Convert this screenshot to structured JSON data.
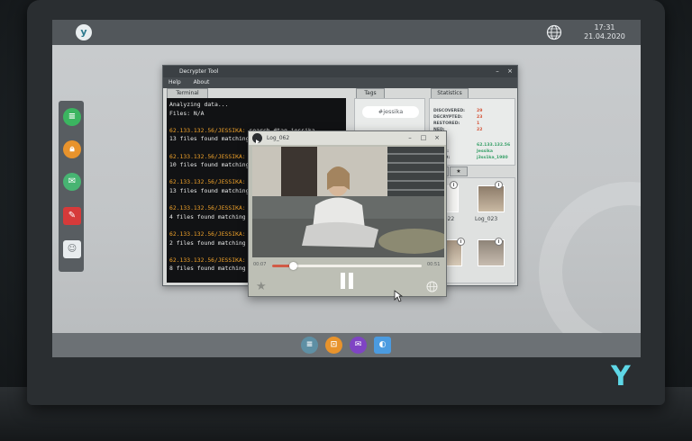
{
  "desktop": {
    "clock_time": "17:31",
    "clock_date": "21.04.2020"
  },
  "icons": {
    "brand": "y-logo-icon",
    "network": "globe-icon",
    "side_dock": [
      "chat-icon",
      "lock-icon",
      "mail-icon",
      "note-icon",
      "contact-icon"
    ],
    "taskbar": [
      "chat-icon",
      "lock-icon",
      "mail-icon",
      "browser-icon"
    ]
  },
  "decrypter": {
    "title": "Decrypter Tool",
    "menu": [
      "Help",
      "About"
    ],
    "tabs": {
      "terminal": "Terminal",
      "tags": "Tags",
      "statistics": "Statistics"
    },
    "terminal_lines": [
      {
        "prompt": "",
        "text": "Analyzing data..."
      },
      {
        "prompt": "",
        "text": "Files: N/A"
      },
      {
        "prompt": "",
        "text": ""
      },
      {
        "prompt": "62.133.132.56/JESSIKA:",
        "text": " search #tag jessika"
      },
      {
        "prompt": "",
        "text": "13 files found matching"
      },
      {
        "prompt": "",
        "text": ""
      },
      {
        "prompt": "62.133.132.56/JESSIKA:",
        "text": ""
      },
      {
        "prompt": "",
        "text": "10 files found matching"
      },
      {
        "prompt": "",
        "text": ""
      },
      {
        "prompt": "62.133.132.56/JESSIKA:",
        "text": ""
      },
      {
        "prompt": "",
        "text": "13 files found matching"
      },
      {
        "prompt": "",
        "text": ""
      },
      {
        "prompt": "62.133.132.56/JESSIKA:",
        "text": ""
      },
      {
        "prompt": "",
        "text": "4 files found matching"
      },
      {
        "prompt": "",
        "text": ""
      },
      {
        "prompt": "62.133.132.56/JESSIKA:",
        "text": ""
      },
      {
        "prompt": "",
        "text": "2 files found matching"
      },
      {
        "prompt": "",
        "text": ""
      },
      {
        "prompt": "62.133.132.56/JESSIKA:",
        "text": ""
      },
      {
        "prompt": "",
        "text": "8 files found matching"
      },
      {
        "prompt": "",
        "text": ""
      },
      {
        "prompt": "62.133.132.56/JESSIKA:",
        "text": ""
      }
    ],
    "tag_chip": "#jessika",
    "stats": [
      {
        "label": "DISCOVERED:",
        "value": "29"
      },
      {
        "label": "DECRYPTED:",
        "value": "23"
      },
      {
        "label": "RESTORED:",
        "value": "1"
      },
      {
        "label": "NED:",
        "value": "22"
      }
    ],
    "credentials": [
      {
        "label": "",
        "value": "62.133.132.56"
      },
      {
        "label": "NAME:",
        "value": "Jessika"
      },
      {
        "label": "WORD:",
        "value": "j3ss1ka_1980"
      }
    ],
    "logs": [
      {
        "label": "Log_022"
      },
      {
        "label": "Log_023"
      }
    ]
  },
  "player": {
    "title": "Log_062",
    "current_time": "00:07",
    "total_time": "00:51",
    "progress": 0.14
  }
}
